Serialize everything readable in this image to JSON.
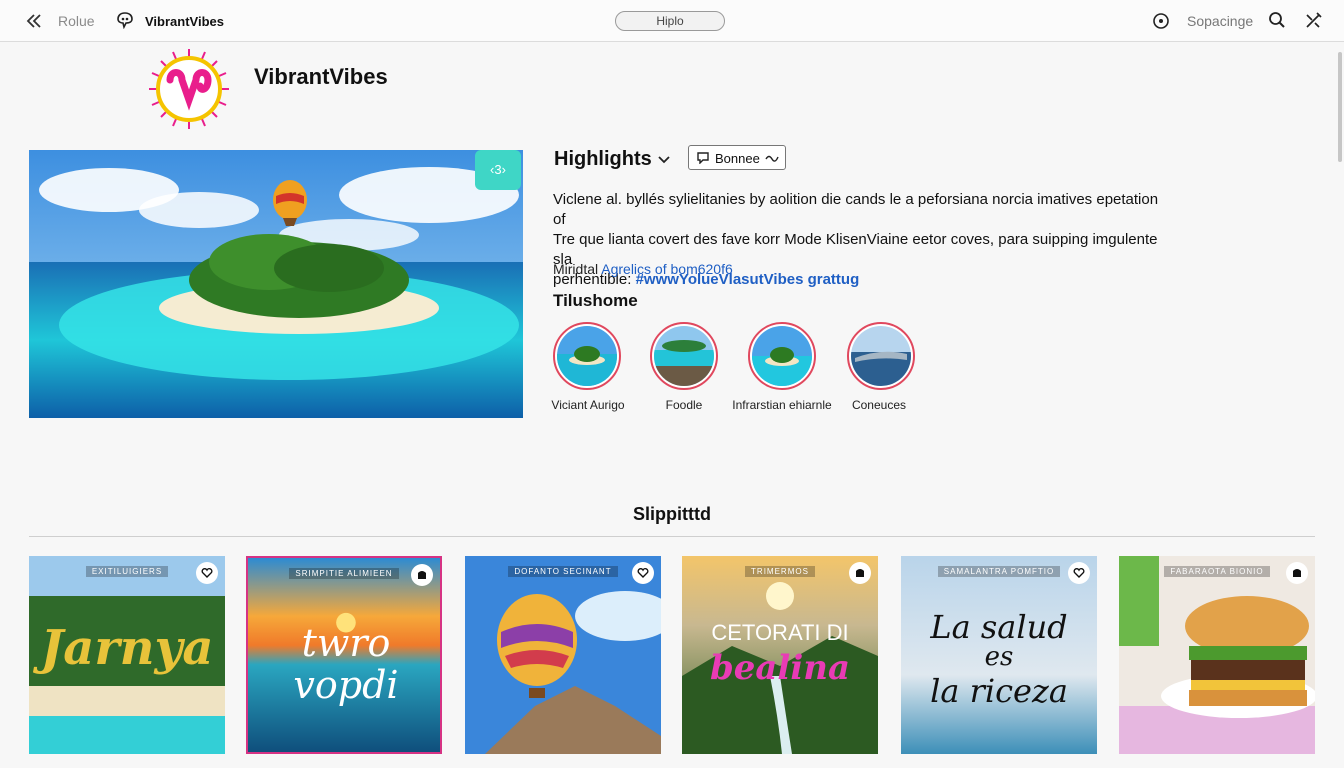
{
  "topbar": {
    "route_label": "Rolue",
    "brand": "VibrantVibes",
    "search_placeholder": "Hiplo",
    "settings_label": "Sopacinge"
  },
  "profile": {
    "name": "VibrantVibes",
    "logo_colors": [
      "#e91e8c",
      "#f5c400"
    ]
  },
  "hero": {
    "badge": "‹3›"
  },
  "highlights": {
    "title": "Highlights",
    "button_label": "Bonnee",
    "description_line1": "Viclene al. byllés sylielitanies by aolition die cands le a peforsiana norcia imatives epetation of",
    "description_line2": "Tre que lianta covert des fave korr Mode KlisenViaine eetor coves, para suipping imgulente sla",
    "description_line3_prefix": "perhentible:",
    "description_link": "#wwwYolueVlasutVibes grattug",
    "meta_label": "Miridtal",
    "meta_link": "Agrelics of bom620f6",
    "section_title": "Tilushome",
    "items": [
      {
        "label": "Viciant Aurigo"
      },
      {
        "label": "Foodle"
      },
      {
        "label": "Infrarstian ehiarnle"
      },
      {
        "label": "Coneuces"
      }
    ]
  },
  "posts_section": {
    "title": "Slippitttd",
    "posts": [
      {
        "caption": "EXITILUIGIERS",
        "text": "Jarnya",
        "icon": "heart-icon"
      },
      {
        "caption": "SRIMPITIE ALIMIEEN",
        "text": "twro vopdi",
        "icon": "bookmark-icon"
      },
      {
        "caption": "DOFANTO SECINANT",
        "text": "",
        "icon": "heart-icon"
      },
      {
        "caption": "TRIMERMOS",
        "text_line1": "CETORATI DI",
        "text_line2": "bealina",
        "icon": "bookmark-icon"
      },
      {
        "caption": "SAMALANTRA POMFTIO",
        "text_line1": "La salud",
        "text_line2": "es",
        "text_line3": "la riceza",
        "icon": "heart-icon"
      },
      {
        "caption": "FABARAOTA BIONIO",
        "text": "",
        "icon": "bookmark-icon"
      }
    ]
  }
}
